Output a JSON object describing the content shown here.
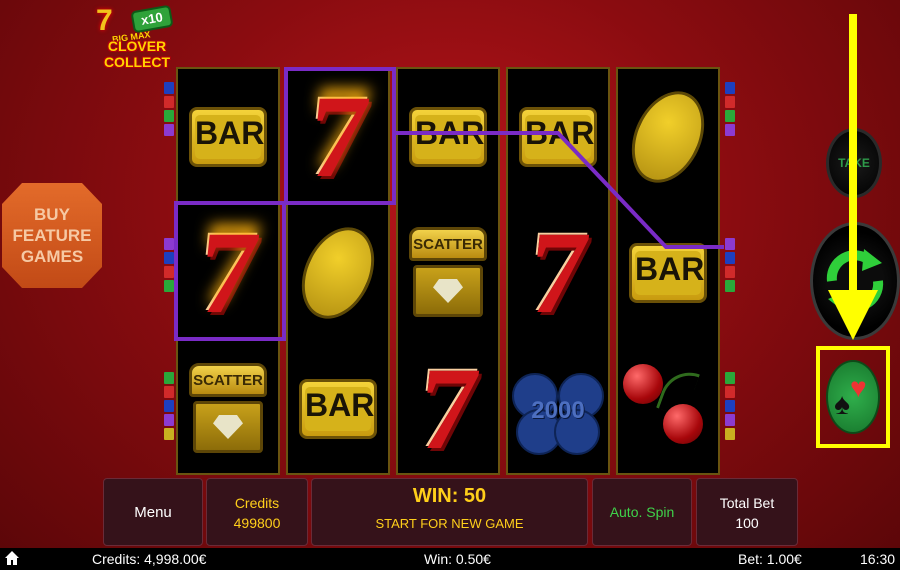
{
  "logo": {
    "multiplier": "x10",
    "big_max": "BIG MAX",
    "line1": "CLOVER",
    "line2": "COLLECT"
  },
  "buy_feature": {
    "label": "BUY\nFEATURE\nGAMES"
  },
  "reels": [
    [
      "bar",
      "seven-fire",
      "scatter"
    ],
    [
      "seven-fire",
      "lemon",
      "bar"
    ],
    [
      "bar",
      "scatter",
      "seven"
    ],
    [
      "bar",
      "seven",
      "clover-2000"
    ],
    [
      "lemon",
      "bar",
      "cherry"
    ]
  ],
  "symbol_text": {
    "bar": "BAR",
    "seven": "7",
    "scatter": "SCATTER",
    "clover": "2000"
  },
  "right_controls": {
    "take_label": "TAKE",
    "gamble_icon": "spade-heart-icon",
    "spin_icon": "refresh-arrows-icon"
  },
  "panel": {
    "menu": "Menu",
    "credits_label": "Credits",
    "credits_value": "499800",
    "win_value": "WIN: 50",
    "win_message": "START FOR NEW GAME",
    "auto_spin": "Auto. Spin",
    "total_bet_label": "Total Bet",
    "total_bet_value": "100"
  },
  "status_bar": {
    "credits": "Credits: 4,998.00€",
    "win": "Win: 0.50€",
    "bet": "Bet: 1.00€",
    "time": "16:30"
  },
  "colors": {
    "background": "#8a0c10",
    "payline": "#7a2bc6",
    "highlight": "#ffff00",
    "gold": "#ffcf1a",
    "auto_spin_green": "#3fd24a"
  }
}
